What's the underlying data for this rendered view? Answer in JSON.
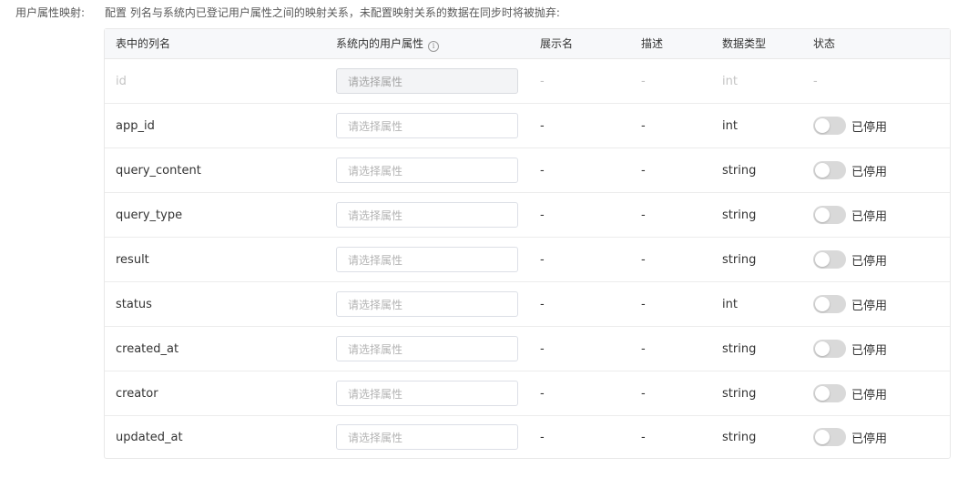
{
  "header": {
    "label": "用户属性映射:",
    "description": "配置 列名与系统内已登记用户属性之间的映射关系，未配置映射关系的数据在同步时将被抛弃:"
  },
  "table": {
    "columns": {
      "col_name": "表中的列名",
      "sys_attr": "系统内的用户属性",
      "display": "展示名",
      "desc": "描述",
      "data_type": "数据类型",
      "status": "状态"
    },
    "rows": [
      {
        "name": "id",
        "placeholder": "请选择属性",
        "display": "-",
        "desc": "-",
        "type": "int",
        "status": "-"
      },
      {
        "name": "app_id",
        "placeholder": "请选择属性",
        "display": "-",
        "desc": "-",
        "type": "int",
        "status": "已停用"
      },
      {
        "name": "query_content",
        "placeholder": "请选择属性",
        "display": "-",
        "desc": "-",
        "type": "string",
        "status": "已停用"
      },
      {
        "name": "query_type",
        "placeholder": "请选择属性",
        "display": "-",
        "desc": "-",
        "type": "string",
        "status": "已停用"
      },
      {
        "name": "result",
        "placeholder": "请选择属性",
        "display": "-",
        "desc": "-",
        "type": "string",
        "status": "已停用"
      },
      {
        "name": "status",
        "placeholder": "请选择属性",
        "display": "-",
        "desc": "-",
        "type": "int",
        "status": "已停用"
      },
      {
        "name": "created_at",
        "placeholder": "请选择属性",
        "display": "-",
        "desc": "-",
        "type": "string",
        "status": "已停用"
      },
      {
        "name": "creator",
        "placeholder": "请选择属性",
        "display": "-",
        "desc": "-",
        "type": "string",
        "status": "已停用"
      },
      {
        "name": "updated_at",
        "placeholder": "请选择属性",
        "display": "-",
        "desc": "-",
        "type": "string",
        "status": "已停用"
      }
    ]
  },
  "icons": {
    "info": "info-icon"
  }
}
